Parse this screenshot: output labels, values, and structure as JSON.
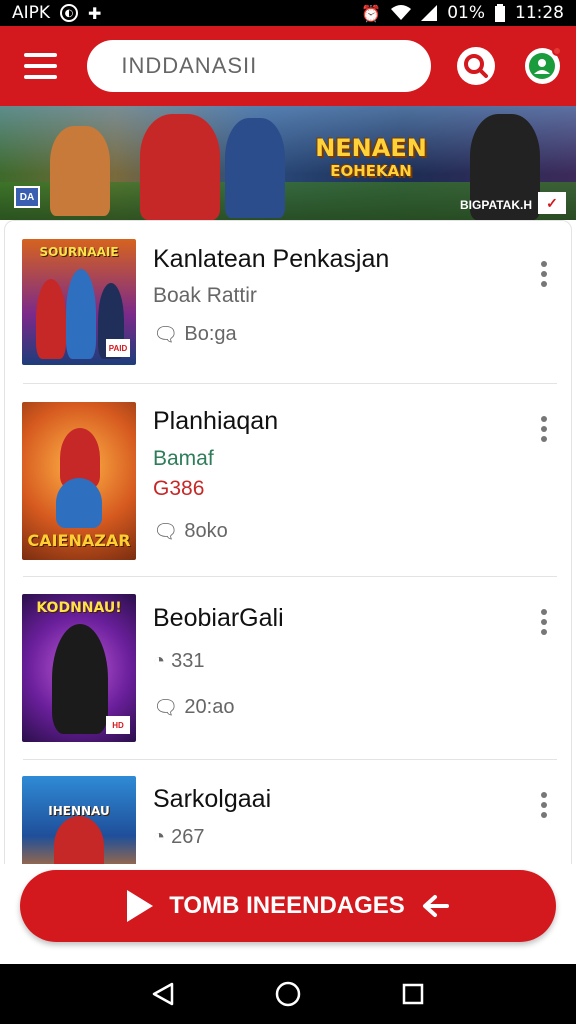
{
  "status_bar": {
    "left_text": "AIPK",
    "battery": "01%",
    "time": "11:28"
  },
  "app_bar": {
    "search_placeholder": "INDDANASII"
  },
  "banner": {
    "title_line1": "NENAEN",
    "title_line2": "EOHEKAN",
    "caption": "BIGPATAK.H"
  },
  "items": [
    {
      "title": "Kanlatean Penkasjan",
      "lines": [
        {
          "text": "Boak Rattir",
          "style": "gray"
        }
      ],
      "meta": "Bo:ga",
      "thumb_label": "SOURNAAIE"
    },
    {
      "title": "Planhiaqan",
      "lines": [
        {
          "text": "Bamaf",
          "style": "green"
        },
        {
          "text": "G386",
          "style": "red"
        }
      ],
      "meta": "8oko",
      "thumb_label": "CAIENAZAR"
    },
    {
      "title": "BeobiarGali",
      "lines": [
        {
          "text": "331",
          "style": "gray"
        }
      ],
      "meta": "20:ao",
      "thumb_label": "KODNNAU!"
    },
    {
      "title": "Sarkolgaai",
      "lines": [
        {
          "text": "267",
          "style": "gray"
        }
      ],
      "meta": "",
      "thumb_label": "IHENNAU"
    }
  ],
  "cta": {
    "label": "TOMB INEENDAGES"
  },
  "colors": {
    "primary": "#d3181e",
    "nav": "#000000"
  }
}
